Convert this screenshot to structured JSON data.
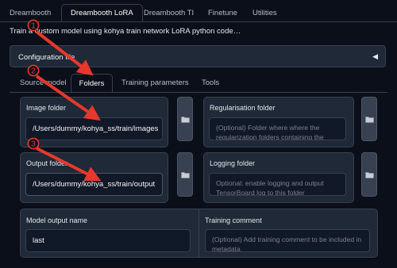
{
  "top_tabs": [
    "Dreambooth",
    "Dreambooth LoRA",
    "Dreambooth TI",
    "Finetune",
    "Utilities"
  ],
  "description": "Train a custom model using kohya train network LoRA python code…",
  "config_file": {
    "label": "Configuration file",
    "collapse_glyph": "◀"
  },
  "sub_tabs": [
    "Source model",
    "Folders",
    "Training parameters",
    "Tools"
  ],
  "image_folder": {
    "label": "Image folder",
    "value": "/Users/dummy/kohya_ss/train/images"
  },
  "regularisation_folder": {
    "label": "Regularisation folder",
    "placeholder": "(Optional) Folder where where the regularization folders containing the"
  },
  "output_folder": {
    "label": "Output folder",
    "value": "/Users/dummy/kohya_ss/train/output"
  },
  "logging_folder": {
    "label": "Logging folder",
    "placeholder": "Optional: enable logging and output TensorBoard log to this folder"
  },
  "model_output_name": {
    "label": "Model output name",
    "value": "last"
  },
  "training_comment": {
    "label": "Training comment",
    "placeholder": "(Optional) Add training comment to be included in metadata"
  },
  "annotations": {
    "badge1": "1",
    "badge2": "2",
    "badge3": "3",
    "color": "#e8372c"
  },
  "icons": {
    "folder_button": "folder-icon"
  }
}
